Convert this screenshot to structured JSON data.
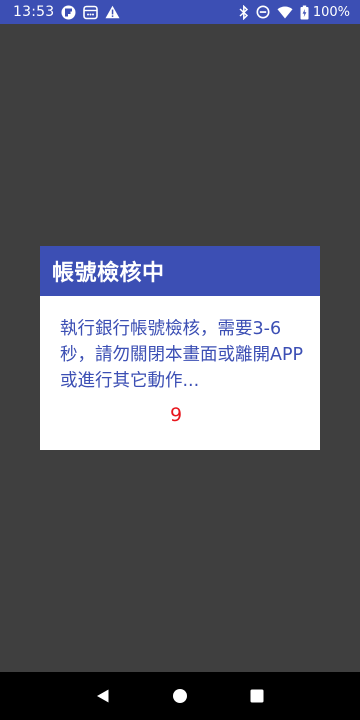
{
  "status_bar": {
    "time": "13:53",
    "left_icons": [
      "flipboard-icon",
      "media-icon",
      "warning-icon"
    ],
    "right_icons": [
      "bluetooth-icon",
      "do-not-disturb-icon",
      "wifi-icon",
      "battery-icon"
    ],
    "battery_text": "100%"
  },
  "dialog": {
    "title": "帳號檢核中",
    "message": "執行銀行帳號檢核，需要3-6秒，請勿關閉本畫面或離開APP或進行其它動作...",
    "countdown": "9",
    "colors": {
      "accent": "#3c4fb4",
      "countdown": "#e8161d",
      "overlay": "#3f3f3f"
    }
  },
  "nav_bar": {
    "buttons": [
      "back-icon",
      "home-icon",
      "recents-icon"
    ]
  }
}
